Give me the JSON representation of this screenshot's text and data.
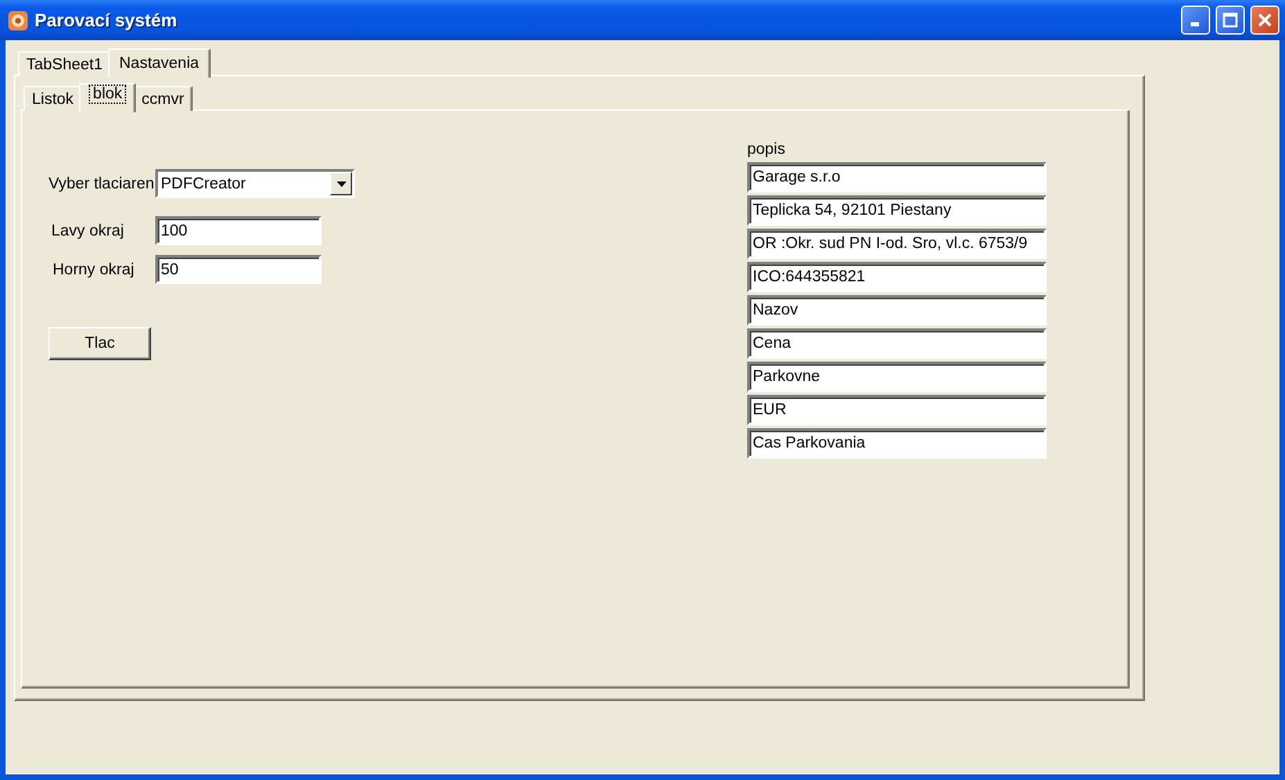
{
  "window": {
    "title": "Parovací systém"
  },
  "outer_tabs": [
    {
      "label": "TabSheet1",
      "selected": false
    },
    {
      "label": "Nastavenia",
      "selected": true
    }
  ],
  "inner_tabs": [
    {
      "label": "Listok",
      "selected": false
    },
    {
      "label": "blok",
      "selected": true
    },
    {
      "label": "ccmvr",
      "selected": false
    }
  ],
  "printer": {
    "label": "Vyber tlaciaren",
    "value": "PDFCreator"
  },
  "margins": [
    {
      "label": "Lavy okraj",
      "value": "100"
    },
    {
      "label": "Horny okraj",
      "value": "50"
    }
  ],
  "print_button": "Tlac",
  "description": {
    "label": "popis",
    "fields": [
      "Garage s.r.o",
      "Teplicka 54, 92101 Piestany",
      "OR :Okr. sud PN I-od. Sro, vl.c. 6753/9",
      "ICO:644355821",
      "Nazov",
      "Cena",
      "Parkovne",
      "EUR",
      "Cas Parkovania"
    ]
  }
}
